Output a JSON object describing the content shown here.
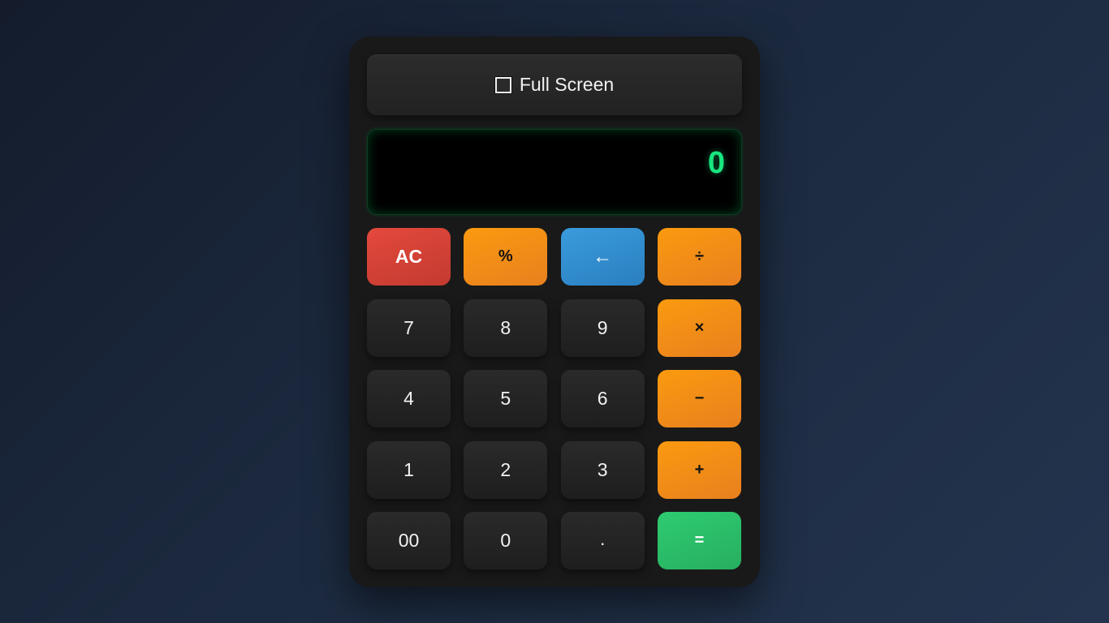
{
  "toggle": {
    "label": "Full Screen",
    "checked": false
  },
  "display": {
    "value": "0"
  },
  "keys": {
    "clear": "AC",
    "percent": "%",
    "backspace": "←",
    "divide": "÷",
    "seven": "7",
    "eight": "8",
    "nine": "9",
    "multiply": "×",
    "four": "4",
    "five": "5",
    "six": "6",
    "subtract": "−",
    "one": "1",
    "two": "2",
    "three": "3",
    "add": "+",
    "double_zero": "00",
    "zero": "0",
    "decimal": ".",
    "equals": "="
  },
  "colors": {
    "display_text": "#19e680",
    "operator": "#fb9a0f",
    "clear": "#e4493c",
    "backspace": "#3a9bdc",
    "equals": "#2ecc71"
  }
}
